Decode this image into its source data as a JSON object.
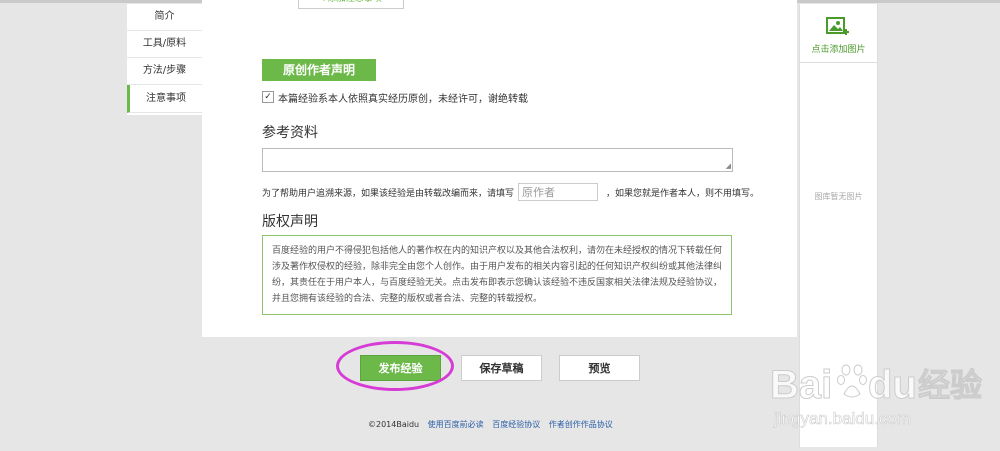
{
  "left_nav": {
    "items": [
      {
        "label": "简介"
      },
      {
        "label": "工具/原料"
      },
      {
        "label": "方法/步骤"
      },
      {
        "label": "注意事项"
      }
    ]
  },
  "top_button": {
    "label": "+添加注意事项"
  },
  "declaration": {
    "header": "原创作者声明",
    "checked": true,
    "checkbox_text": "本篇经验系本人依照真实经历原创，未经许可，谢绝转载"
  },
  "reference": {
    "title": "参考资料",
    "source_prefix": "为了帮助用户追溯来源，如果该经验是由转载改编而来，请填写",
    "author_placeholder": "原作者",
    "source_suffix": "，如果您就是作者本人，则不用填写。"
  },
  "copyright": {
    "title": "版权声明",
    "lines": [
      "百度经验的用户不得侵犯包括他人的著作权在内的知识产权以及其他合法权利，请勿在未经授权的情况下转载任何",
      "涉及著作权侵权的经验，除非完全由您个人创作。由于用户发布的相关内容引起的任何知识产权纠纷或其他法律纠",
      "纷，其责任在于用户本人，与百度经验无关。点击发布即表示您确认该经验不违反国家相关法律法规及经验协议，",
      "并且您拥有该经验的合法、完整的版权或者合法、完整的转载授权。"
    ]
  },
  "right_panel": {
    "add_image_label": "点击添加图片",
    "empty_label": "图库暂无图片",
    "icon": "image-add-icon"
  },
  "actions": {
    "publish": "发布经验",
    "save_draft": "保存草稿",
    "preview": "预览"
  },
  "footer": {
    "copyright": "©2014Baidu",
    "links": [
      "使用百度前必读",
      "百度经验协议",
      "作者创作作品协议"
    ]
  },
  "watermark": {
    "brand": "Bai",
    "brand_suffix": "du",
    "cn": "经验",
    "url": "jingyan.baidu.com"
  },
  "colors": {
    "accent_green": "#6cb94a",
    "highlight_circle": "#d63bd6",
    "link_blue": "#2a5fa8"
  }
}
